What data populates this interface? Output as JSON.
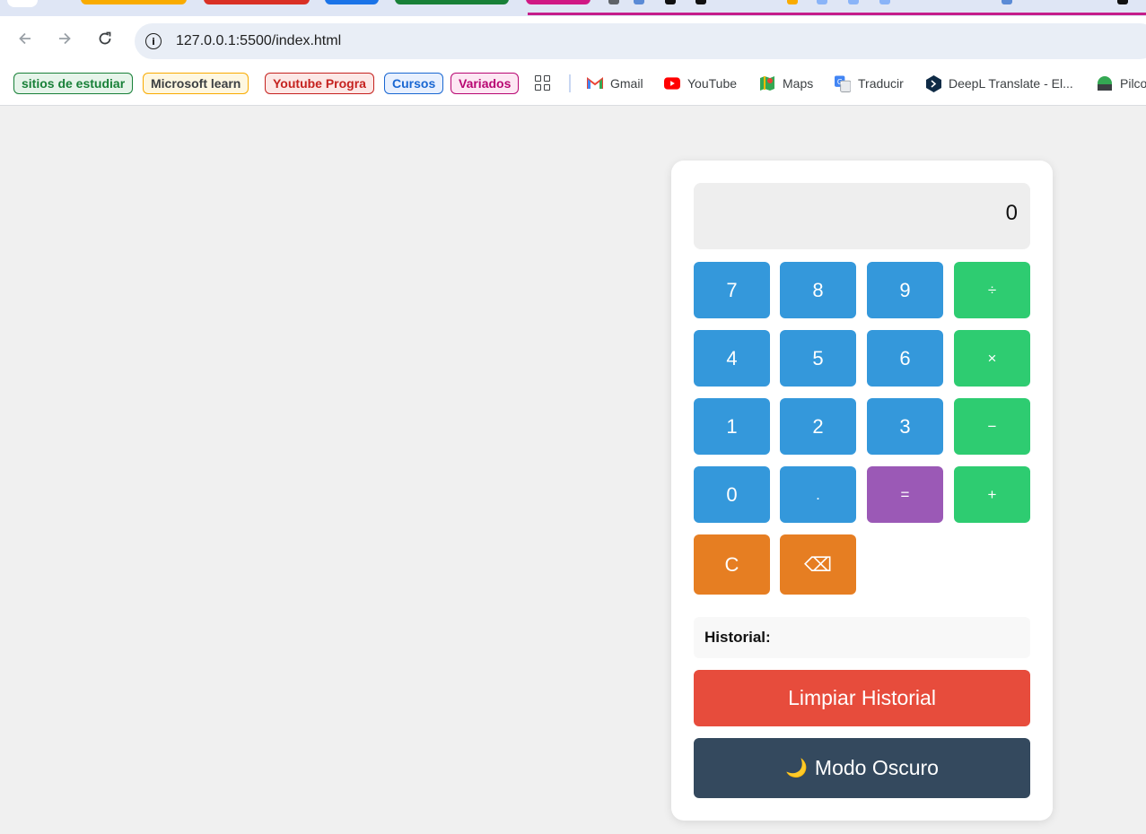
{
  "browser": {
    "url": "127.0.0.1:5500/index.html",
    "bookmark_groups": [
      {
        "label": "sitios de estudiar",
        "color": "#188038",
        "bg": "#e6f4ea"
      },
      {
        "label": "Microsoft  learn",
        "color": "#3c4043",
        "bg": "#fef7e0",
        "border": "#f9ab00"
      },
      {
        "label": "Youtube Progra",
        "color": "#c5221f",
        "bg": "#fce8e6"
      },
      {
        "label": "Cursos",
        "color": "#1967d2",
        "bg": "#e8f0fe"
      },
      {
        "label": "Variados",
        "color": "#b80672",
        "bg": "#fde7f3"
      }
    ],
    "bookmarks": [
      {
        "label": "Gmail",
        "icon": "gmail-icon"
      },
      {
        "label": "YouTube",
        "icon": "youtube-icon"
      },
      {
        "label": "Maps",
        "icon": "maps-icon"
      },
      {
        "label": "Traducir",
        "icon": "translate-icon"
      },
      {
        "label": "DeepL Translate - El...",
        "icon": "deepl-icon"
      },
      {
        "label": "Pilco",
        "icon": "pilco-icon"
      }
    ]
  },
  "calculator": {
    "display": "0",
    "keys": {
      "k7": "7",
      "k8": "8",
      "k9": "9",
      "div": "÷",
      "k4": "4",
      "k5": "5",
      "k6": "6",
      "mul": "×",
      "k1": "1",
      "k2": "2",
      "k3": "3",
      "sub": "−",
      "k0": "0",
      "dot": ".",
      "eq": "=",
      "add": "+",
      "clear": "C",
      "backspace": "⌫"
    },
    "history_label": "Historial:",
    "clear_history_label": "Limpiar Historial",
    "dark_mode_label": "Modo Oscuro",
    "dark_mode_icon": "🌙",
    "colors": {
      "number": "#3498db",
      "operator": "#2ecc71",
      "equals": "#9b59b6",
      "clear": "#e67e22",
      "clear_history": "#e74c3c",
      "dark_mode": "#34495e"
    }
  }
}
